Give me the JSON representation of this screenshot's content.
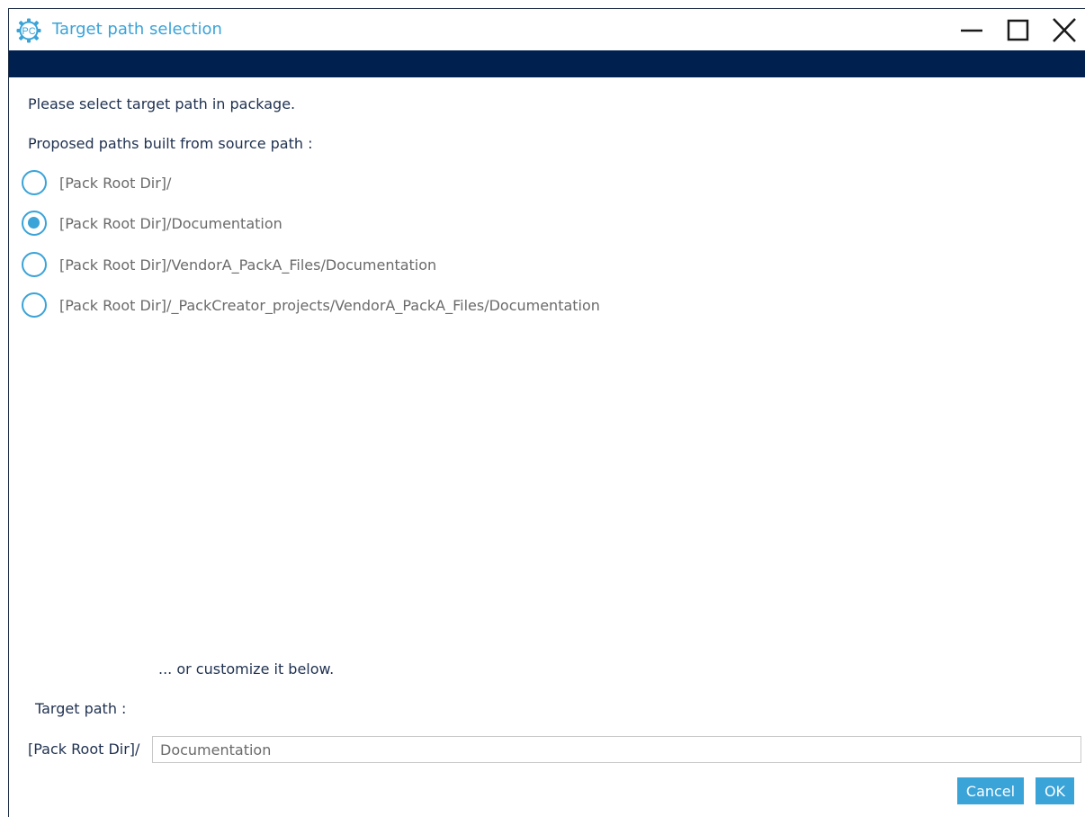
{
  "window": {
    "title": "Target path selection",
    "app_icon_text": "PC"
  },
  "content": {
    "instruction": "Please select target path in package.",
    "proposed_label": "Proposed paths built from source path :",
    "options": [
      {
        "label": "[Pack Root Dir]/",
        "selected": false
      },
      {
        "label": "[Pack Root Dir]/Documentation",
        "selected": true
      },
      {
        "label": "[Pack Root Dir]/VendorA_PackA_Files/Documentation",
        "selected": false
      },
      {
        "label": "[Pack Root Dir]/_PackCreator_projects/VendorA_PackA_Files/Documentation",
        "selected": false
      }
    ],
    "customize_label": "... or customize it below.",
    "target_path_label": "Target path :",
    "target_prefix": "[Pack Root Dir]/",
    "target_value": "Documentation"
  },
  "buttons": {
    "cancel": "Cancel",
    "ok": "OK"
  },
  "colors": {
    "accent": "#3aa3d8",
    "banner": "#00204f",
    "text": "#1f3150",
    "muted_text": "#6a6a6a"
  },
  "icons": {
    "app": "gear-pc-icon",
    "minimize": "minimize-icon",
    "maximize": "maximize-icon",
    "close": "close-icon"
  }
}
